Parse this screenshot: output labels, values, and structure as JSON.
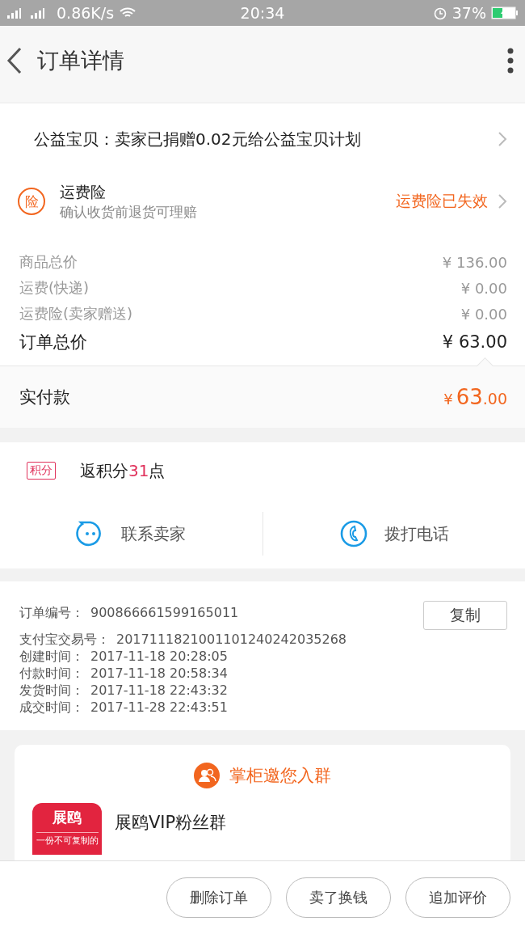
{
  "status_bar": {
    "network_speed": "0.86K/s",
    "time": "20:34",
    "battery": "37%"
  },
  "header": {
    "title": "订单详情"
  },
  "charity": {
    "text": "公益宝贝：卖家已捐赠0.02元给公益宝贝计划"
  },
  "insurance": {
    "badge": "险",
    "title": "运费险",
    "subtitle": "确认收货前退货可理赔",
    "status": "运费险已失效"
  },
  "prices": [
    {
      "label": "商品总价",
      "value": "¥ 136.00",
      "kind": "minor"
    },
    {
      "label": "运费(快递)",
      "value": "¥ 0.00",
      "kind": "minor"
    },
    {
      "label": "运费险(卖家赠送)",
      "value": "¥ 0.00",
      "kind": "minor"
    },
    {
      "label": "订单总价",
      "value": "¥ 63.00",
      "kind": "total"
    }
  ],
  "paid": {
    "label": "实付款",
    "currency": "¥",
    "amount": "63",
    "decimals": ".00"
  },
  "points": {
    "badge": "积分",
    "prefix": "返积分",
    "value": "31",
    "suffix": "点"
  },
  "actions": [
    {
      "label": "联系卖家",
      "kind": "chat"
    },
    {
      "label": "拨打电话",
      "kind": "phone"
    }
  ],
  "order_info": {
    "copy_button": "复制",
    "fields": [
      {
        "label": "订单编号：",
        "value": "900866661599165011"
      },
      {
        "label": "支付宝交易号：",
        "value": "2017111821001101240242035268"
      },
      {
        "label": "创建时间：",
        "value": "2017-11-18 20:28:05"
      },
      {
        "label": "付款时间：",
        "value": "2017-11-18 20:58:34"
      },
      {
        "label": "发货时间：",
        "value": "2017-11-18 22:43:32"
      },
      {
        "label": "成交时间：",
        "value": "2017-11-28 22:43:51"
      }
    ]
  },
  "group_card": {
    "title": "掌柜邀您入群",
    "logo_text": "展鸥",
    "logo_tagline": "一份不可复制的",
    "name": "展鸥VIP粉丝群"
  },
  "bottom_buttons": [
    "删除订单",
    "卖了换钱",
    "追加评价"
  ]
}
